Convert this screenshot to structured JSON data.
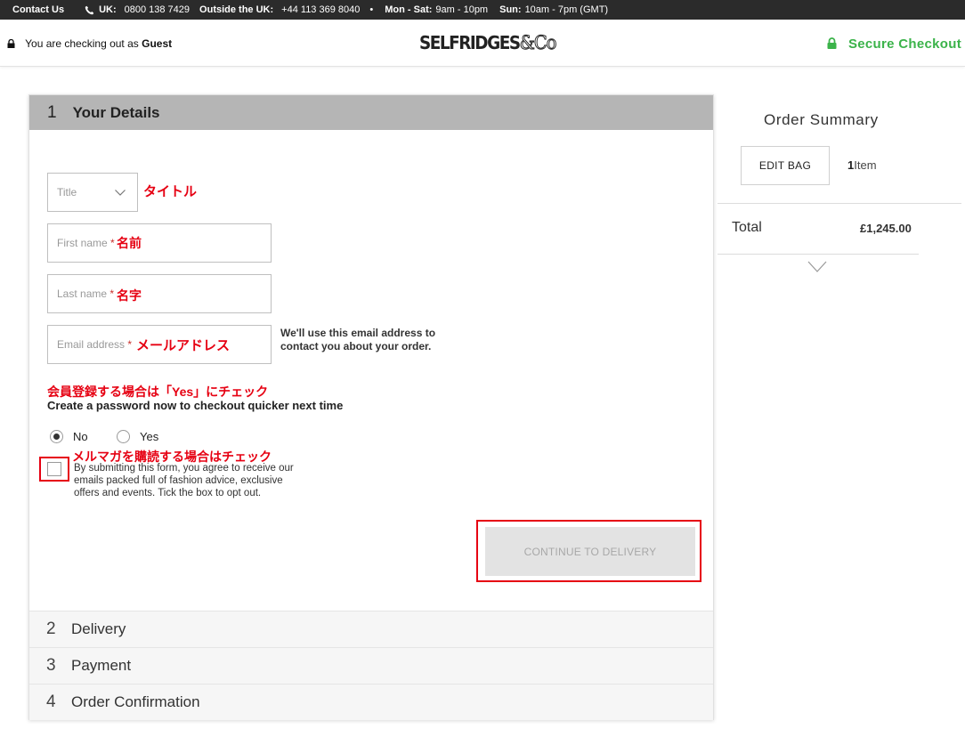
{
  "topbar": {
    "contact": "Contact Us",
    "uk_label": "UK:",
    "uk_phone": "0800 138 7429",
    "outside_label": "Outside the UK:",
    "outside_phone": "+44 113 369 8040",
    "separator": "•",
    "weekday_label": "Mon - Sat:",
    "weekday_hours": "9am - 10pm",
    "sunday_label": "Sun:",
    "sunday_hours": "10am - 7pm (GMT)"
  },
  "header": {
    "guest_prefix": "You are checking out as",
    "guest_name": "Guest",
    "logo_text": "SELFRIDGES",
    "logo_suffix": "&Co",
    "secure_label": "Secure Checkout"
  },
  "details": {
    "step_num": "1",
    "title": "Your Details",
    "title_field": {
      "placeholder": "Title",
      "annotation": "タイトル"
    },
    "first_name": {
      "placeholder": "First name",
      "required": "*",
      "annotation": "名前"
    },
    "last_name": {
      "placeholder": "Last name",
      "required": "*",
      "annotation": "名字"
    },
    "email": {
      "placeholder": "Email address",
      "required": "*",
      "annotation": "メールアドレス"
    },
    "email_note": "We'll use this email address to contact you about your order.",
    "member_annotation": "会員登録する場合は「Yes」にチェック",
    "password_prompt": "Create a password now to checkout quicker next time",
    "radio_no": "No",
    "radio_yes": "Yes",
    "selected_radio": "No",
    "newsletter_annotation": "メルマガを購読する場合はチェック",
    "newsletter_text": "By submitting this form, you agree to receive our emails packed full of fashion advice, exclusive offers and events. Tick the box to opt out.",
    "newsletter_checked": false,
    "continue_label": "CONTINUE TO DELIVERY"
  },
  "steps": [
    {
      "num": "2",
      "label": "Delivery"
    },
    {
      "num": "3",
      "label": "Payment"
    },
    {
      "num": "4",
      "label": "Order Confirmation"
    }
  ],
  "summary": {
    "title": "Order Summary",
    "edit_bag": "EDIT BAG",
    "item_count": "1",
    "item_label": "Item",
    "total_label": "Total",
    "total_value": "£1,245.00"
  },
  "colors": {
    "topbar_bg": "#2b2b2b",
    "secure_green": "#3bb34a",
    "annotation_red": "#e60012",
    "step_header_bg": "#b5b5b5",
    "disabled_button_bg": "#e3e3e3"
  }
}
